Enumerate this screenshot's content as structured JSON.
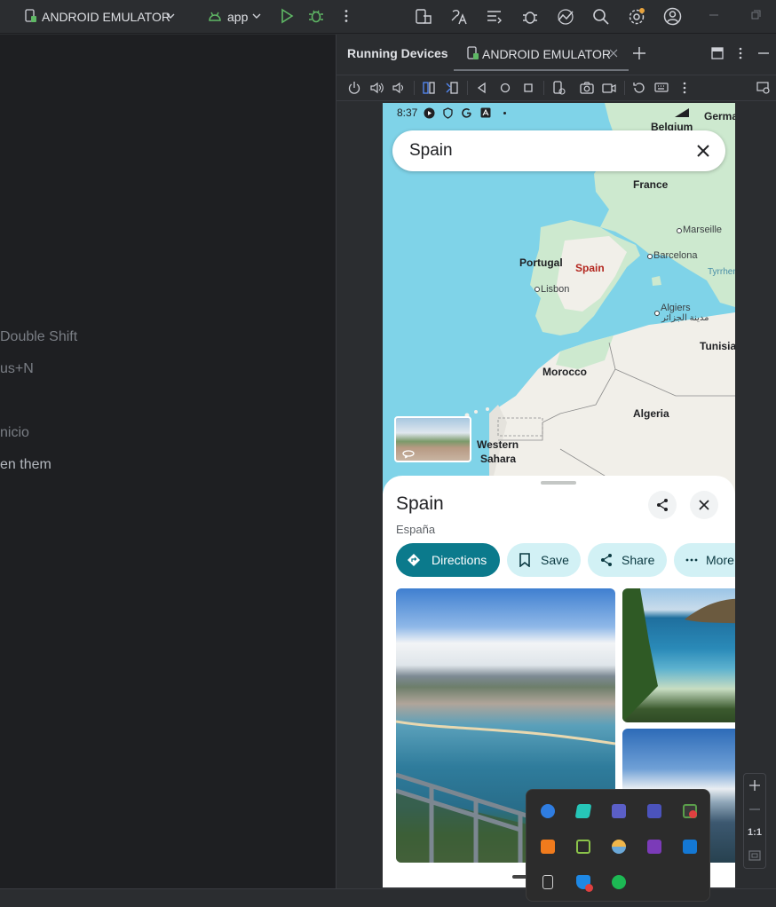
{
  "toolbar": {
    "device_selector": "ANDROID EMULATOR",
    "run_config": "app"
  },
  "editor_hints": [
    {
      "text": "Double Shift"
    },
    {
      "text": "us+N"
    },
    {
      "text": "nicio"
    },
    {
      "text": "en them"
    }
  ],
  "running_devices": {
    "title": "Running Devices",
    "tab_label": "ANDROID EMULATOR"
  },
  "zoom": {
    "ratio_label": "1:1"
  },
  "phone": {
    "status_time": "8:37",
    "search_query": "Spain",
    "map_labels": {
      "belgium": "Belgium",
      "germany": "Germa",
      "france": "France",
      "marseille": "Marseille",
      "portugal": "Portugal",
      "spain": "Spain",
      "barcelona": "Barcelona",
      "tyrrhenian": "Tyrrhen",
      "lisbon": "Lisbon",
      "algiers": "Algiers",
      "algiers_ar": "مدينة الجزائر",
      "tunisia": "Tunisia",
      "morocco": "Morocco",
      "algeria": "Algeria",
      "western_sahara_1": "Western",
      "western_sahara_2": "Sahara"
    },
    "place": {
      "name": "Spain",
      "local_name": "España"
    },
    "actions": {
      "directions": "Directions",
      "save": "Save",
      "share": "Share",
      "more": "More"
    }
  },
  "colors": {
    "ide_bg": "#2b2d30",
    "editor_bg": "#1e1f22",
    "accent_teal": "#0b7a8c",
    "chip_bg": "#d2f1f5",
    "map_water": "#7fd3e8",
    "map_land": "#f1efe9",
    "map_green": "#c5e8c8"
  }
}
